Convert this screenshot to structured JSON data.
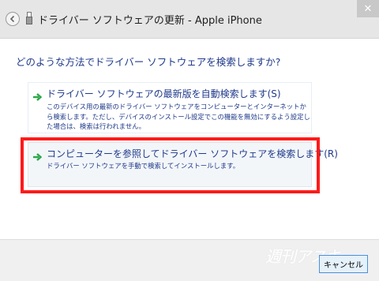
{
  "window": {
    "title": "ドライバー ソフトウェアの更新 - Apple iPhone",
    "back_icon": "back-arrow-icon",
    "close_glyph": "✕"
  },
  "main": {
    "question": "どのような方法でドライバー ソフトウェアを検索しますか?",
    "options": [
      {
        "title": "ドライバー ソフトウェアの最新版を自動検索します(S)",
        "description": "このデバイス用の最新のドライバー ソフトウェアをコンピューターとインターネットから検索します。ただし、デバイスのインストール設定でこの機能を無効にするよう設定した場合は、検索は行われません。"
      },
      {
        "title": "コンピューターを参照してドライバー ソフトウェアを検索します(R)",
        "description": "ドライバー ソフトウェアを手動で検索してインストールします。"
      }
    ]
  },
  "footer": {
    "watermark": "週刊アスキー",
    "cancel_label": "キャンセル"
  },
  "colors": {
    "accent_text": "#1f3a8a",
    "highlight": "#ff1a1a",
    "arrow": "#2aa84a"
  }
}
